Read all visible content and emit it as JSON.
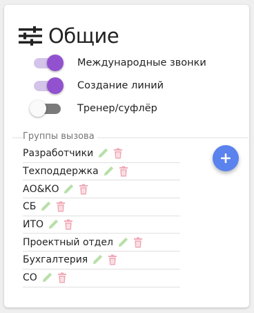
{
  "section": {
    "title": "Общие",
    "icon": "sliders-icon"
  },
  "toggles": [
    {
      "label": "Международные звонки",
      "enabled": true
    },
    {
      "label": "Создание линий",
      "enabled": true
    },
    {
      "label": "Тренер/суфлёр",
      "enabled": false
    }
  ],
  "call_groups": {
    "legend": "Группы вызова",
    "add_icon": "plus-icon",
    "edit_icon": "pencil-icon",
    "delete_icon": "trash-icon",
    "items": [
      {
        "name": "Разработчики"
      },
      {
        "name": "Техподдержка"
      },
      {
        "name": "АО&КО"
      },
      {
        "name": "СБ"
      },
      {
        "name": "ИТО"
      },
      {
        "name": "Проектный отдел"
      },
      {
        "name": "Бухгалтерия"
      },
      {
        "name": "СО"
      }
    ]
  },
  "colors": {
    "switch_on": "#9251cf",
    "switch_on_track": "#d4c4ea",
    "fab": "#5b83ee",
    "edit": "#b8dfa8",
    "delete": "#f0a7b5"
  }
}
